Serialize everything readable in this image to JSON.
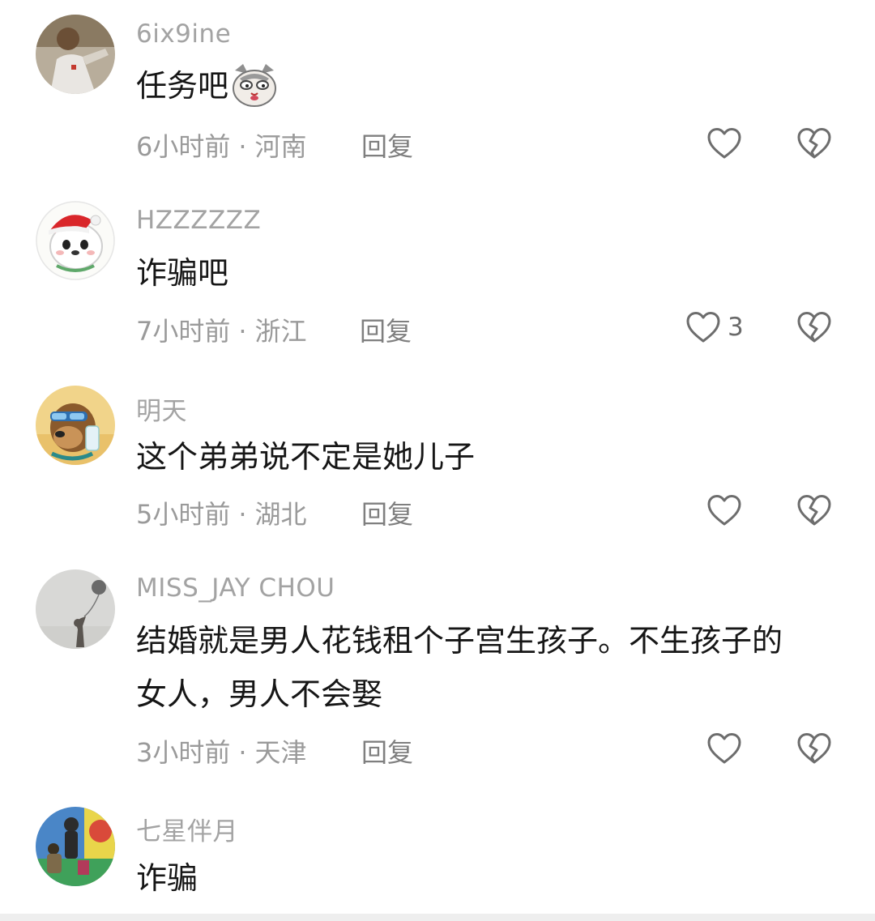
{
  "comments": [
    {
      "username": "6ix9ine",
      "text": "任务吧",
      "emoji": "cat-emoji",
      "time": "6小时前",
      "separator": "·",
      "location": "河南",
      "reply_label": "回复",
      "like_count": "",
      "avatar_icon": "person-photo-avatar"
    },
    {
      "username": "HZZZZZZ",
      "text": "诈骗吧",
      "time": "7小时前",
      "separator": "·",
      "location": "浙江",
      "reply_label": "回复",
      "like_count": "3",
      "avatar_icon": "christmas-dog-avatar"
    },
    {
      "username": "明天",
      "text": "这个弟弟说不定是她儿子",
      "time": "5小时前",
      "separator": "·",
      "location": "湖北",
      "reply_label": "回复",
      "like_count": "",
      "avatar_icon": "cartoon-dog-avatar"
    },
    {
      "username": "MISS_JAY CHOU",
      "text_line1": "结婚就是男人花钱租个子宫生孩子。不生孩子的",
      "text_line2": "女人，男人不会娶",
      "time": "3小时前",
      "separator": "·",
      "location": "天津",
      "reply_label": "回复",
      "like_count": "",
      "avatar_icon": "balloon-photo-avatar"
    },
    {
      "username": "七星伴月",
      "text": "诈骗",
      "avatar_icon": "playground-photo-avatar"
    }
  ],
  "icons": {
    "like": "heart-outline-icon",
    "dislike": "broken-heart-icon"
  }
}
